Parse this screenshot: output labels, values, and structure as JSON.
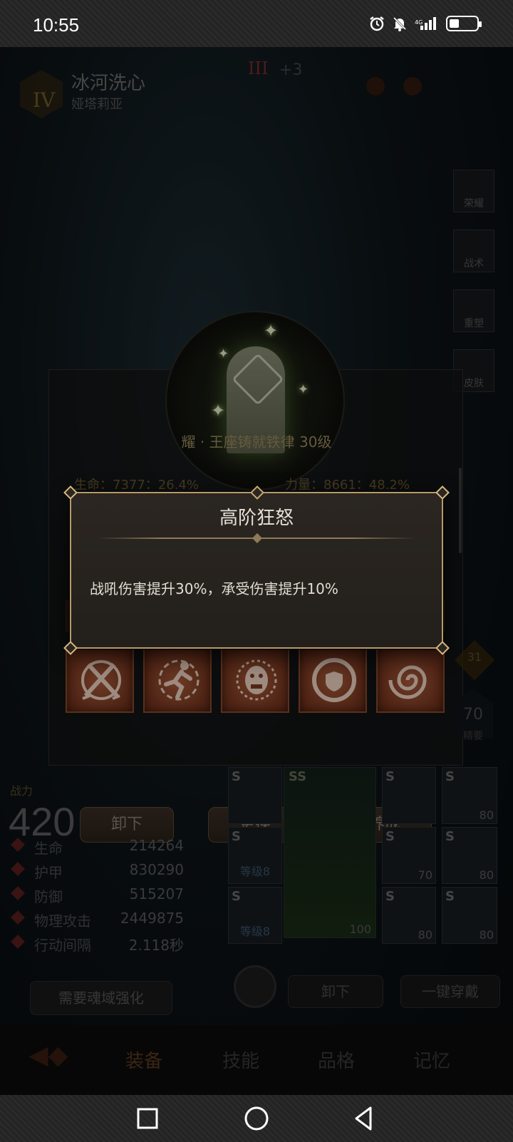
{
  "status_bar": {
    "time": "10:55",
    "icons": [
      "alarm-icon",
      "mute-icon",
      "signal-icon",
      "battery-icon"
    ],
    "battery_level": 0.35
  },
  "hero": {
    "rank_badge": "IV",
    "name": "冰河洗心",
    "sub": "娅塔莉亚",
    "rank_numeral": "III",
    "rank_plus": "+3"
  },
  "side_menu": [
    {
      "label": "荣耀"
    },
    {
      "label": "战术"
    },
    {
      "label": "重塑"
    },
    {
      "label": "皮肤"
    }
  ],
  "item": {
    "title": "耀 · 王座铸就铁律  30级",
    "stat_left": "生命：7377：26.4%",
    "stat_right": "力量：8661：48.2%"
  },
  "popup": {
    "title": "高阶狂怒",
    "description": "战吼伤害提升30%，承受伤害提升10%"
  },
  "skills": [
    {
      "name": "crossed-swords-icon"
    },
    {
      "name": "sprint-icon"
    },
    {
      "name": "rage-face-icon"
    },
    {
      "name": "shield-spin-icon"
    },
    {
      "name": "vortex-icon"
    }
  ],
  "side_badges": {
    "level_small": "31",
    "level_big": "70",
    "level_big_label": "精要"
  },
  "stats": {
    "power_label": "战力",
    "power_value": "420",
    "actions": {
      "unequip": "卸下",
      "replace": "更换",
      "develop": "养成"
    },
    "attrs": [
      {
        "key": "生命",
        "value": "214264"
      },
      {
        "key": "护甲",
        "value": "830290"
      },
      {
        "key": "防御",
        "value": "515207"
      },
      {
        "key": "物理攻击",
        "value": "2449875"
      },
      {
        "key": "行动间隔",
        "value": "2.118秒"
      }
    ],
    "need_button": "需要魂域强化"
  },
  "equipment": {
    "slots": [
      {
        "grade": "S",
        "level": "",
        "tag": ""
      },
      {
        "grade": "SS",
        "level": "",
        "tag": ""
      },
      {
        "grade": "S",
        "level": "",
        "tag": ""
      },
      {
        "grade": "S",
        "level": "80",
        "tag": ""
      },
      {
        "grade": "S",
        "level": "",
        "tag": "等级8"
      },
      {
        "grade": "S",
        "level": "70",
        "tag": ""
      },
      {
        "grade": "S",
        "level": "80",
        "tag": ""
      },
      {
        "grade": "S",
        "level": "",
        "tag": "等级8"
      },
      {
        "grade": "S",
        "level": "80",
        "tag": ""
      },
      {
        "grade": "S",
        "level": "80",
        "tag": ""
      }
    ],
    "weapon_level": "100",
    "unequip2": "卸下",
    "one_click": "一键穿戴"
  },
  "tabs": [
    {
      "label": "装备"
    },
    {
      "label": "技能"
    },
    {
      "label": "品格"
    },
    {
      "label": "记忆"
    }
  ],
  "nav": [
    "recents-icon",
    "home-icon",
    "back-icon"
  ],
  "colors": {
    "popup_border": "#b89a6a",
    "popup_bg": "#2b2622",
    "skill_bg": "#7d3a22"
  }
}
